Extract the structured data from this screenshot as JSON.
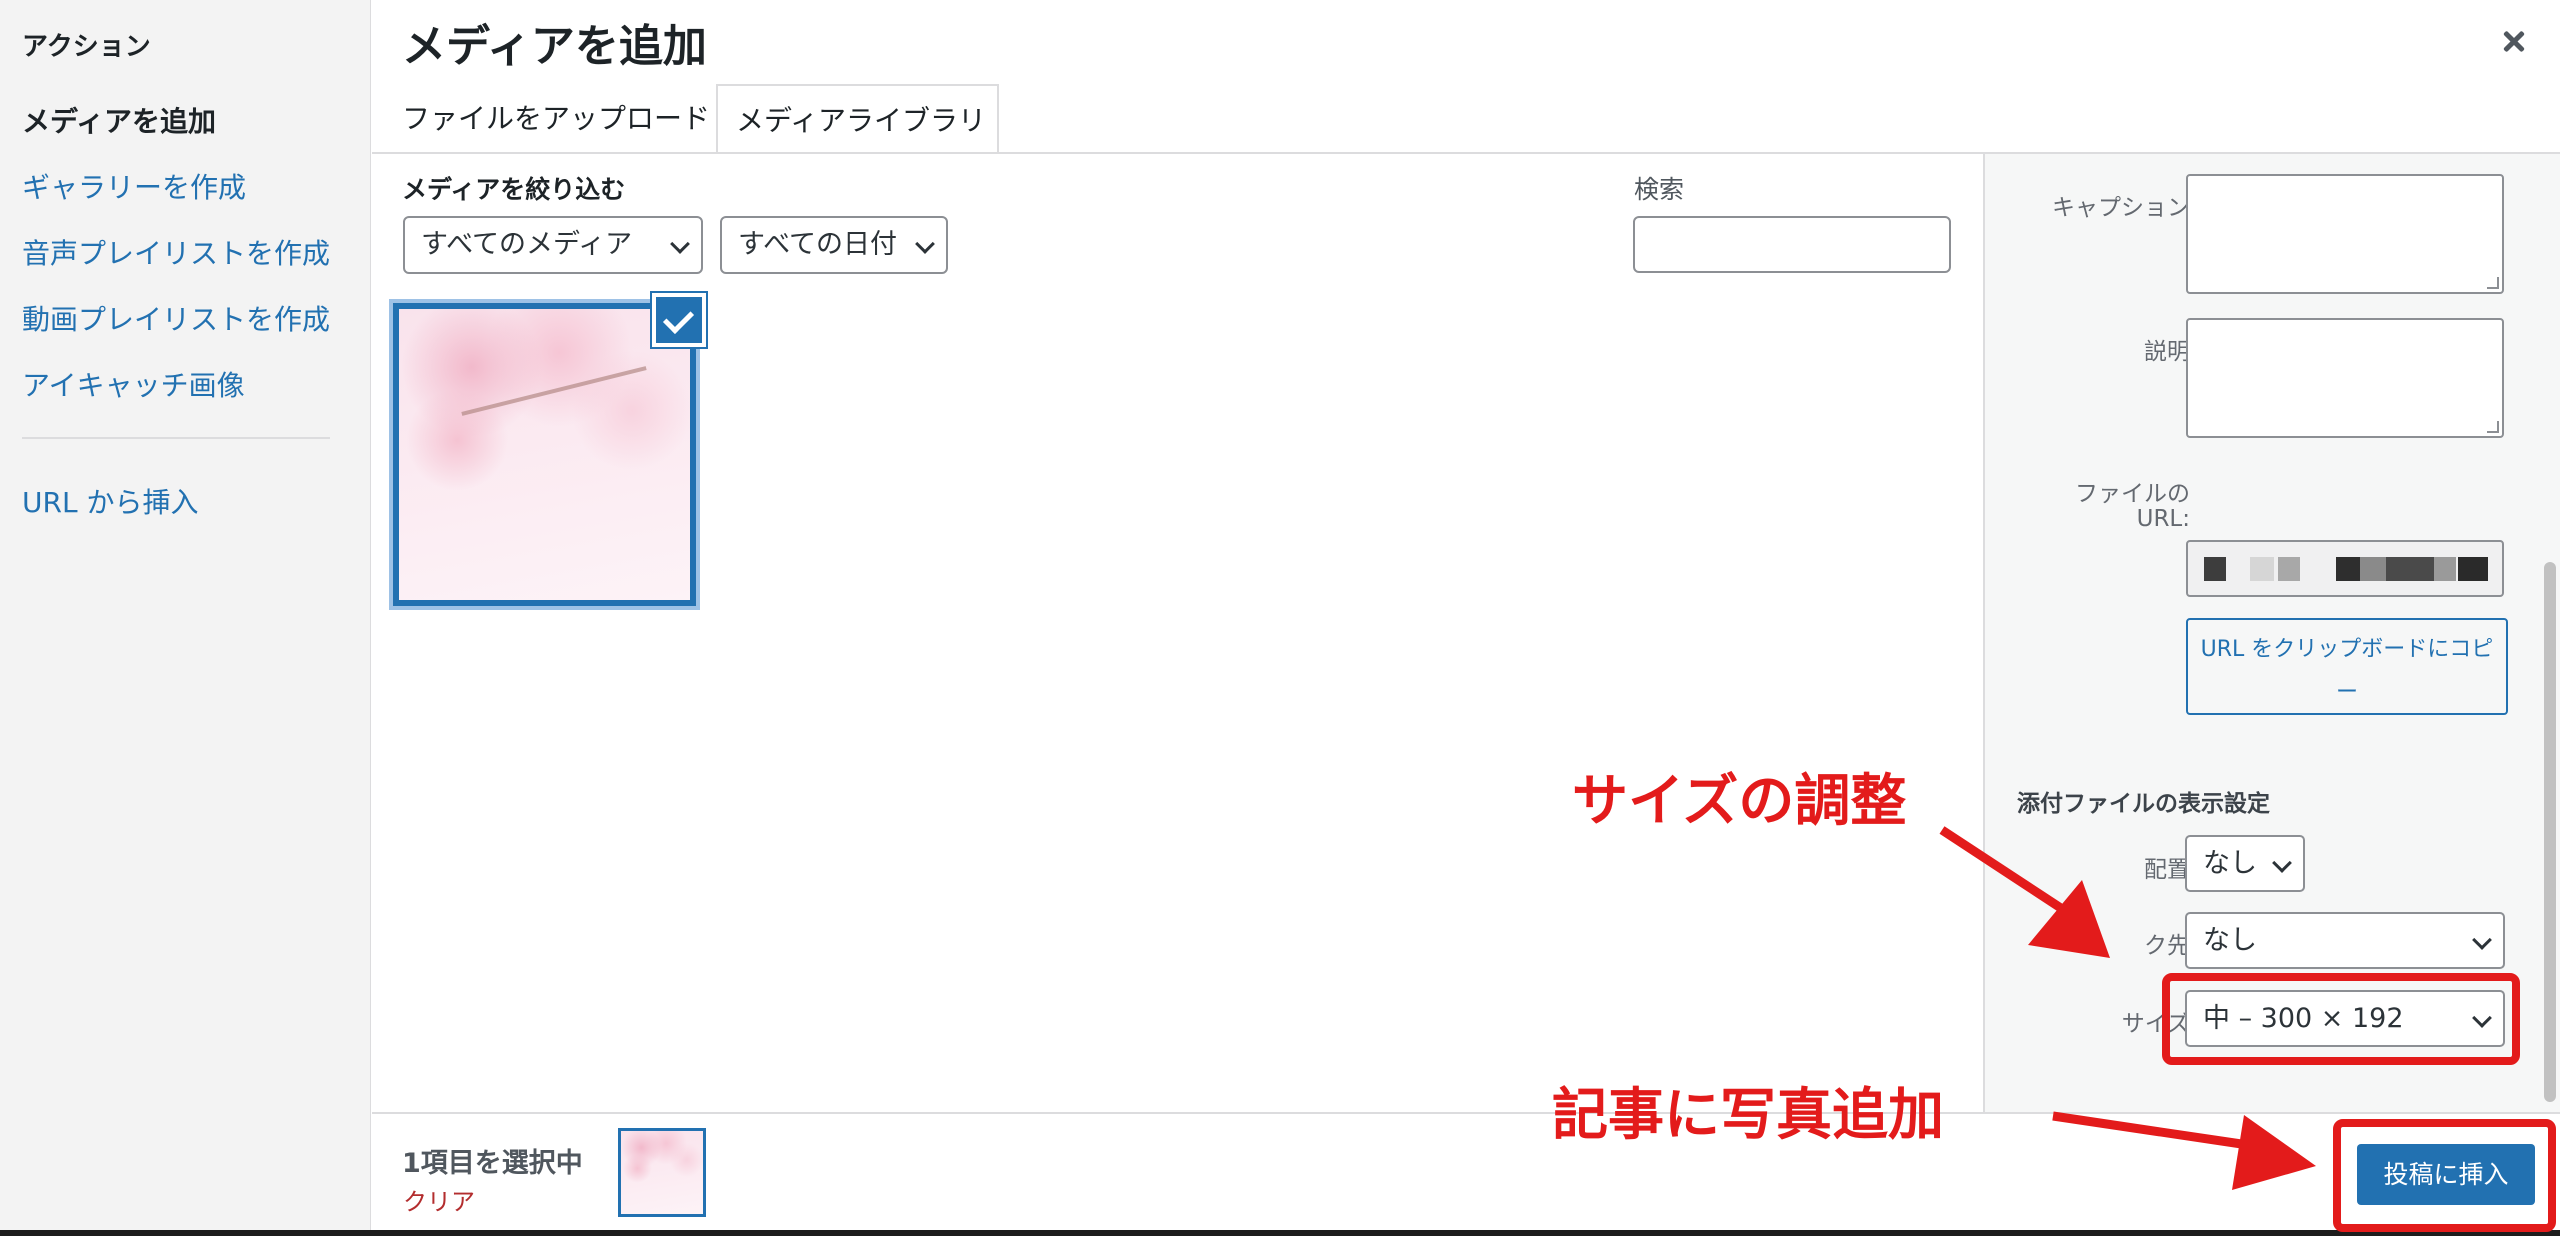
{
  "sidebar": {
    "heading": "アクション",
    "items": [
      {
        "label": "メディアを追加",
        "active": true
      },
      {
        "label": "ギャラリーを作成"
      },
      {
        "label": "音声プレイリストを作成"
      },
      {
        "label": "動画プレイリストを作成"
      },
      {
        "label": "アイキャッチ画像"
      },
      {
        "label": "URL から挿入"
      }
    ]
  },
  "frame": {
    "title": "メディアを追加",
    "close_icon": "close-icon",
    "tabs": [
      {
        "label": "ファイルをアップロード"
      },
      {
        "label": "メディアライブラリ",
        "active": true
      }
    ]
  },
  "toolbar": {
    "filter_label": "メディアを絞り込む",
    "media_filter_value": "すべてのメディア",
    "date_filter_value": "すべての日付",
    "search_label": "検索",
    "search_value": ""
  },
  "details": {
    "caption_label": "キャプション",
    "description_label": "説明",
    "file_url_label_line1": "ファイルの",
    "file_url_label_line2": "URL:",
    "copy_button_line1": "URL をクリップボードにコピ",
    "copy_button_line2": "ー",
    "display_settings_heading": "添付ファイルの表示設定",
    "align_label": "配置",
    "align_value": "なし",
    "link_label": "ク先",
    "link_value": "なし",
    "size_label": "サイズ",
    "size_value": "中 – 300 × 192"
  },
  "bottom": {
    "selection_count": "1項目を選択中",
    "clear_label": "クリア",
    "insert_button": "投稿に挿入"
  },
  "annotations": {
    "size_note": "サイズの調整",
    "insert_note": "記事に写真追加",
    "color": "#e31b1b"
  },
  "colors": {
    "accent": "#2271b1",
    "link": "#2271b1",
    "danger": "#b32d2e"
  }
}
